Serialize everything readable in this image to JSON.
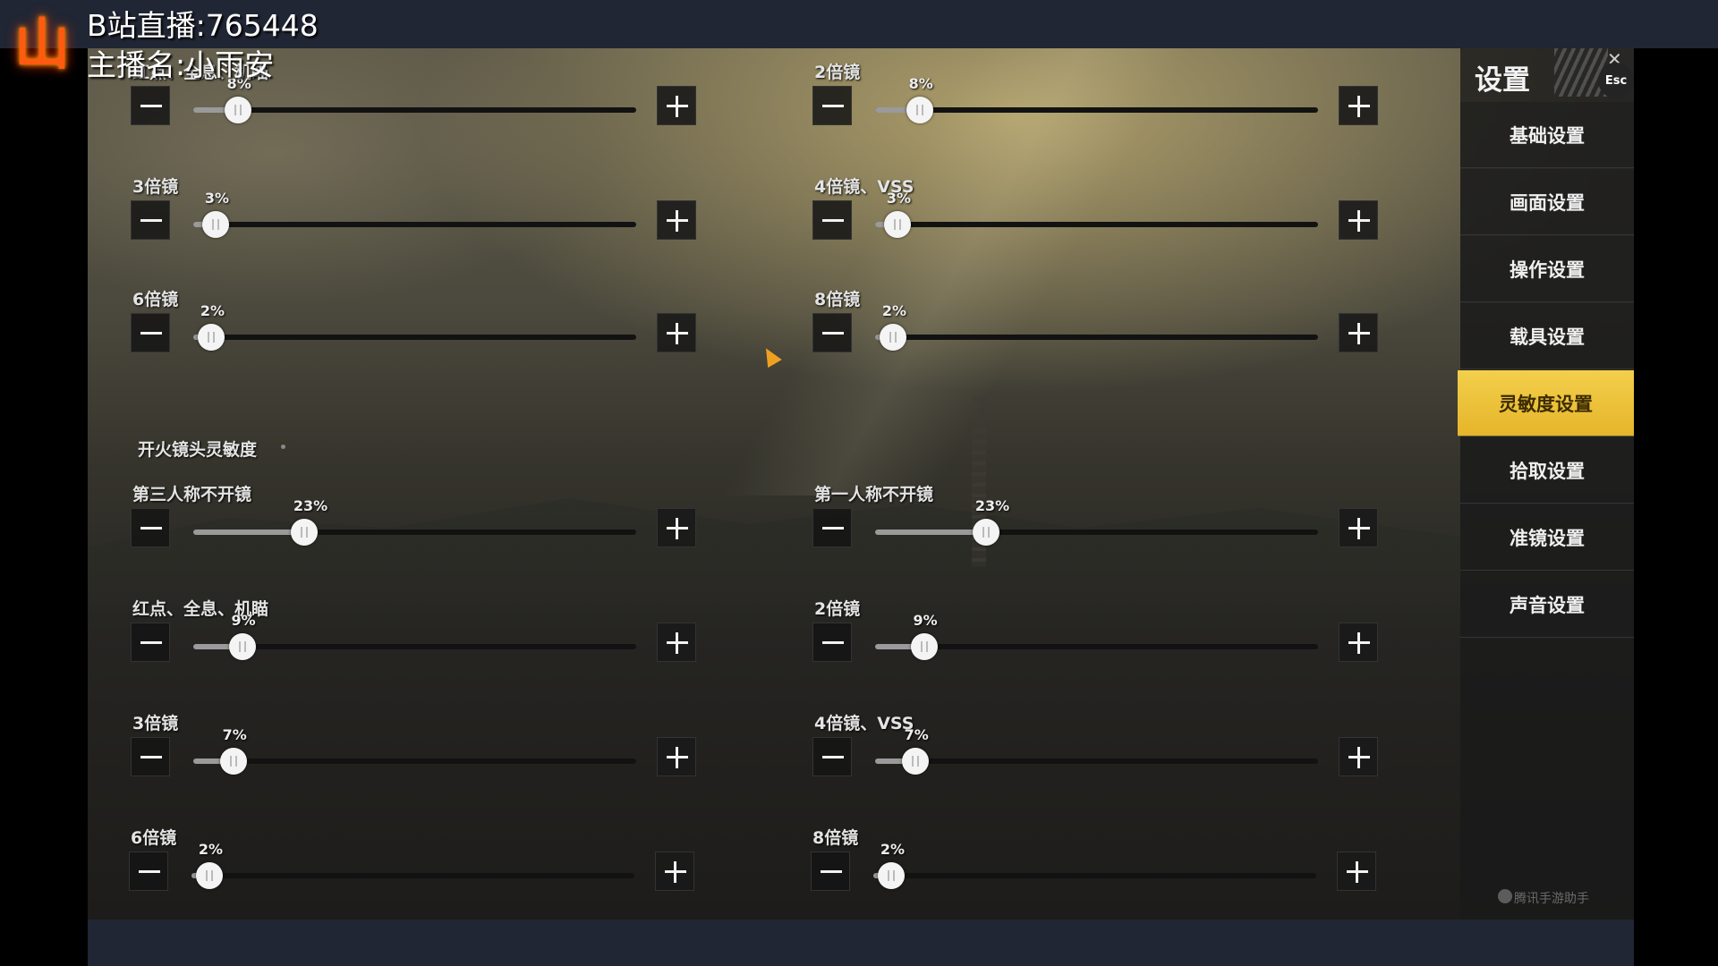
{
  "stream": {
    "channel": "B站直播:765448",
    "host": "主播名:小雨安",
    "logo": "山"
  },
  "settings": {
    "title": "设置",
    "esc_label": "Esc",
    "menu": [
      {
        "label": "基础设置",
        "active": false
      },
      {
        "label": "画面设置",
        "active": false
      },
      {
        "label": "操作设置",
        "active": false
      },
      {
        "label": "载具设置",
        "active": false
      },
      {
        "label": "灵敏度设置",
        "active": true
      },
      {
        "label": "拾取设置",
        "active": false
      },
      {
        "label": "准镜设置",
        "active": false
      },
      {
        "label": "声音设置",
        "active": false
      }
    ],
    "watermark": "腾讯手游助手"
  },
  "section_top": {
    "sliders": [
      {
        "label": "红点、全息、机瞄",
        "value": 8,
        "pct": "8%"
      },
      {
        "label": "2倍镜",
        "value": 8,
        "pct": "8%"
      },
      {
        "label": "3倍镜",
        "value": 3,
        "pct": "3%"
      },
      {
        "label": "4倍镜、VSS",
        "value": 3,
        "pct": "3%"
      },
      {
        "label": "6倍镜",
        "value": 2,
        "pct": "2%"
      },
      {
        "label": "8倍镜",
        "value": 2,
        "pct": "2%"
      }
    ]
  },
  "section_fire": {
    "title": "开火镜头灵敏度",
    "sliders": [
      {
        "label": "第三人称不开镜",
        "value": 23,
        "pct": "23%"
      },
      {
        "label": "第一人称不开镜",
        "value": 23,
        "pct": "23%"
      },
      {
        "label": "红点、全息、机瞄",
        "value": 9,
        "pct": "9%"
      },
      {
        "label": "2倍镜",
        "value": 9,
        "pct": "9%"
      },
      {
        "label": "3倍镜",
        "value": 7,
        "pct": "7%"
      },
      {
        "label": "4倍镜、VSS",
        "value": 7,
        "pct": "7%"
      },
      {
        "label": "6倍镜",
        "value": 2,
        "pct": "2%"
      },
      {
        "label": "8倍镜",
        "value": 2,
        "pct": "2%"
      }
    ]
  }
}
